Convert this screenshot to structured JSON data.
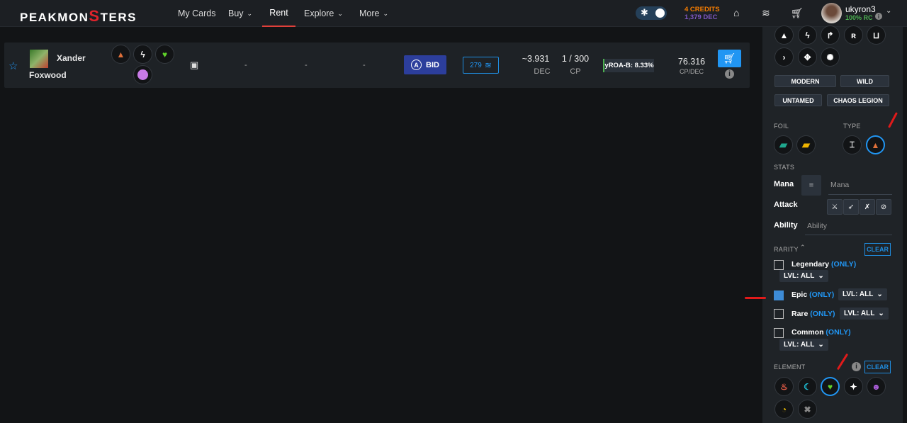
{
  "header": {
    "logo": "PEAKMONSTERS",
    "nav": [
      {
        "label": "My Cards"
      },
      {
        "label": "Buy"
      },
      {
        "label": "Rent"
      },
      {
        "label": "Explore"
      },
      {
        "label": "More"
      }
    ],
    "credits": "4 CREDITS",
    "dec": "1,379 DEC",
    "username": "ukyron3",
    "rc": "100% RC"
  },
  "row": {
    "name_first": "Xander",
    "name_last": "Foxwood",
    "dash1": "-",
    "dash2": "-",
    "dash3": "-",
    "bid_label": "BID",
    "stack_count": "279",
    "dec_value": "~3.931",
    "dec_label": "DEC",
    "cp_value": "1 / 300",
    "cp_label": "CP",
    "yroa": "yROA-B: 8.33%",
    "cp_dec_value": "76.316",
    "cp_dec_label": "CP/DEC"
  },
  "sidebar": {
    "modern": "MODERN",
    "wild": "WILD",
    "untamed": "UNTAMED",
    "chaos": "CHAOS LEGION",
    "foil": "FOIL",
    "type": "TYPE",
    "stats": "STATS",
    "mana": "Mana",
    "mana_op": "=",
    "mana_placeholder": "Mana",
    "attack": "Attack",
    "ability": "Ability",
    "ability_placeholder": "Ability",
    "rarity": "RARITY",
    "clear": "CLEAR",
    "only": "(ONLY)",
    "lvl": "LVL: ALL",
    "rarities": [
      {
        "name": "Legendary",
        "checked": false
      },
      {
        "name": "Epic",
        "checked": true
      },
      {
        "name": "Rare",
        "checked": false
      },
      {
        "name": "Common",
        "checked": false
      }
    ],
    "element": "ELEMENT"
  },
  "colors": {
    "accent": "#2196f3",
    "bid": "#2c3e9c",
    "credits": "#f57c00",
    "dec": "#7e57c2",
    "rc": "#4caf50",
    "annotation": "#e01a1a"
  }
}
